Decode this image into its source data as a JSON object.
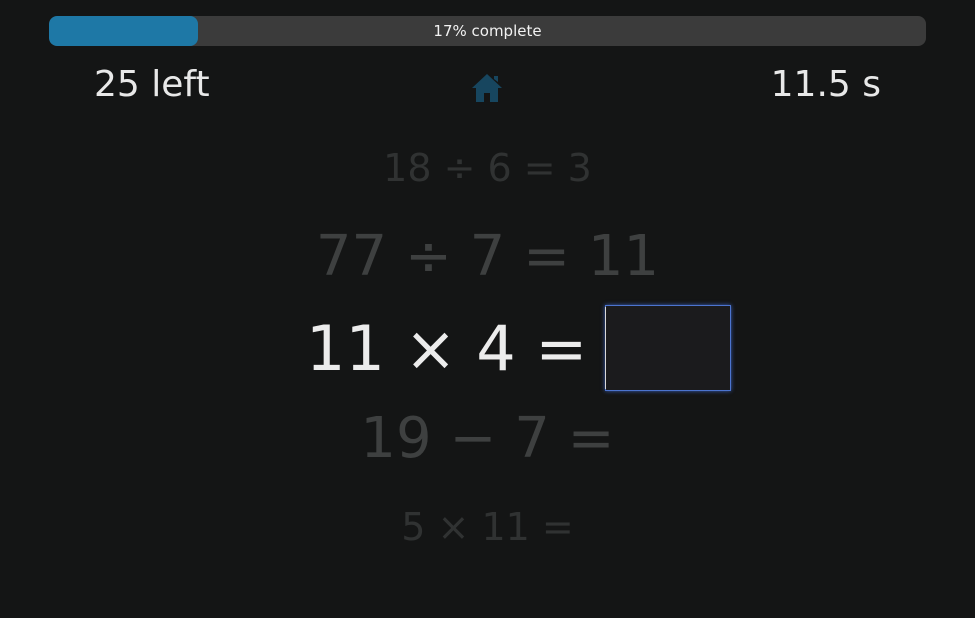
{
  "progress": {
    "label": "17% complete",
    "fraction": 0.17,
    "fill_color": "#1e78a6",
    "track_color": "#3b3b3b"
  },
  "status": {
    "remaining": "25 left",
    "timer": "11.5 s"
  },
  "home": {
    "icon": "home-icon",
    "color": "#17465f"
  },
  "equations": {
    "prev2": "18 ÷ 6 = 3",
    "prev1": "77 ÷ 7 = 11",
    "current": "11 × 4 =",
    "answer_value": "",
    "next1": "19 − 7 =",
    "next2": "5 × 11 ="
  }
}
